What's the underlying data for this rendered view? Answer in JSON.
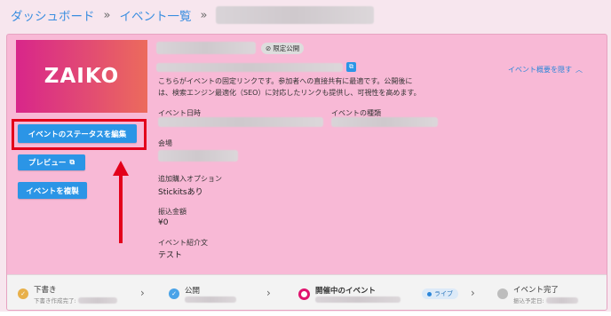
{
  "breadcrumb": {
    "dashboard": "ダッシュボード",
    "sep": "»",
    "events": "イベント一覧"
  },
  "logo": "ZAIKO",
  "buttons": {
    "edit_status": "イベントのステータスを編集",
    "preview": "プレビュー",
    "duplicate": "イベントを複製"
  },
  "badge": "限定公開",
  "description": "こちらがイベントの固定リンクです。参加者への直接共有に最適です。公開後には、検索エンジン最適化（SEO）に対応したリンクも提供し、可視性を高めます。",
  "hide_summary": "イベント概要を隠す",
  "fields": {
    "date_label": "イベント日時",
    "type_label": "イベントの種類",
    "venue_label": "会場",
    "option_label": "追加購入オプション",
    "option_value": "Stickitsあり",
    "payout_label": "振込金額",
    "payout_value": "¥0",
    "intro_label": "イベント紹介文",
    "intro_value": "テスト"
  },
  "steps": [
    {
      "title": "下書き",
      "sub": "下書き作成完了:"
    },
    {
      "title": "公開",
      "sub": ""
    },
    {
      "title": "開催中のイベント",
      "sub": "",
      "badge": "ライブ"
    },
    {
      "title": "イベント完了",
      "sub": "振込予定日:"
    }
  ],
  "colors": {
    "accent": "#2b95e6",
    "card": "#f8b9d6",
    "highlight": "#e3001b"
  }
}
